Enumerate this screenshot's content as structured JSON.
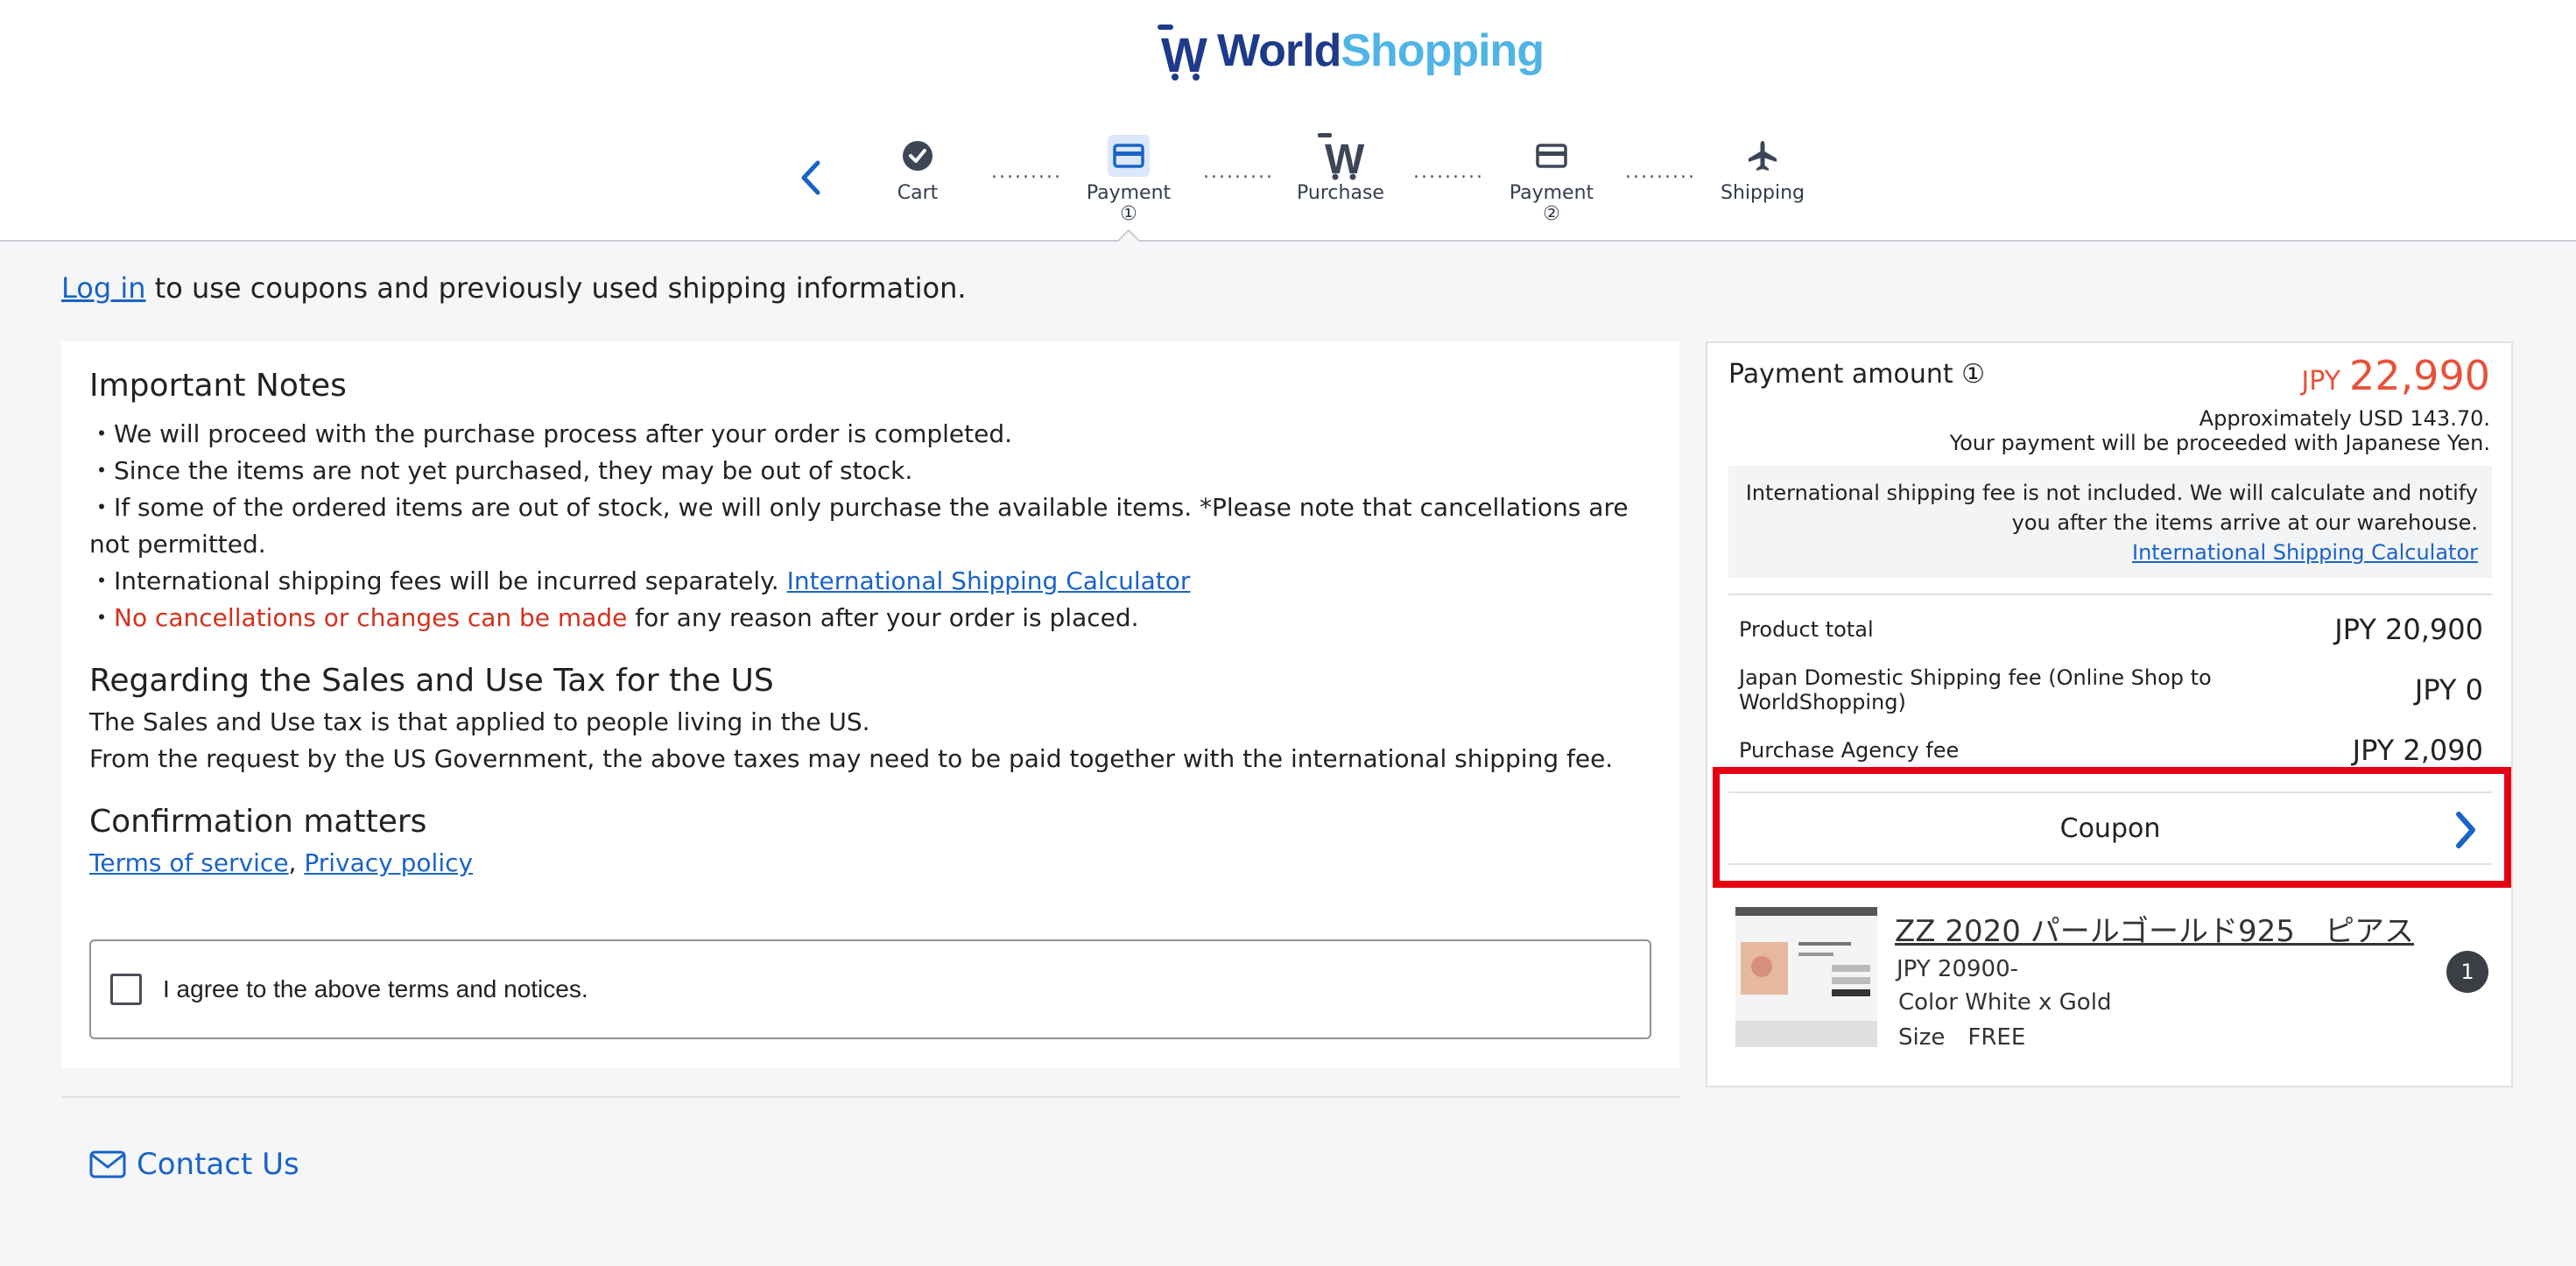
{
  "header": {
    "logo_part1": "World",
    "logo_part2": "Shopping",
    "steps": [
      {
        "label": "Cart",
        "num": ""
      },
      {
        "label": "Payment",
        "num": "①"
      },
      {
        "label": "Purchase",
        "num": ""
      },
      {
        "label": "Payment",
        "num": "②"
      },
      {
        "label": "Shipping",
        "num": ""
      }
    ],
    "dots": "........."
  },
  "login": {
    "link": "Log in",
    "text": " to use coupons and previously used shipping information."
  },
  "notes": {
    "title": "Important Notes",
    "line1": "・We will proceed with the purchase process after your order is completed.",
    "line2": "・Since the items are not yet purchased, they may be out of stock.",
    "line3": "・If some of the ordered items are out of stock, we will only purchase the available items. *Please note that cancellations are not permitted.",
    "line4_text": "・International shipping fees will be incurred separately. ",
    "line4_link": "International Shipping Calculator",
    "line5_prefix": "・",
    "line5_red": "No cancellations or changes can be made",
    "line5_rest": " for any reason after your order is placed.",
    "tax_title": "Regarding the Sales and Use Tax for the US",
    "tax_line1": "The Sales and Use tax is that applied to people living in the US.",
    "tax_line2": "From the request by the US Government, the above taxes may need to be paid together with the international shipping fee.",
    "confirm_title": "Confirmation matters",
    "terms_link": "Terms of service",
    "comma": ", ",
    "privacy_link": "Privacy policy",
    "agree_text": "I agree to the above terms and notices."
  },
  "contact": {
    "label": "Contact Us"
  },
  "summary": {
    "title": "Payment amount ①",
    "currency": "JPY",
    "amount": "22,990",
    "approx": "Approximately USD 143.70.",
    "yen_note": "Your payment will be proceeded with Japanese Yen.",
    "intl_note": "International shipping fee is not included. We will calculate and notify you after the items arrive at our warehouse.",
    "intl_link": "International Shipping Calculator",
    "rows": [
      {
        "label": "Product total",
        "value": "JPY 20,900"
      },
      {
        "label": "Japan Domestic Shipping fee (Online Shop to WorldShopping)",
        "value": "JPY 0"
      },
      {
        "label": "Purchase Agency fee",
        "value": "JPY 2,090"
      }
    ],
    "coupon_label": "Coupon",
    "product": {
      "title": "ZZ 2020 パールゴールド925　ピアス",
      "price": "JPY 20900-",
      "color": "Color White x Gold",
      "size": "Size　FREE",
      "qty": "1"
    }
  },
  "colors": {
    "accent": "#1a63c8",
    "price": "#e8523a",
    "highlight": "#e60012"
  }
}
